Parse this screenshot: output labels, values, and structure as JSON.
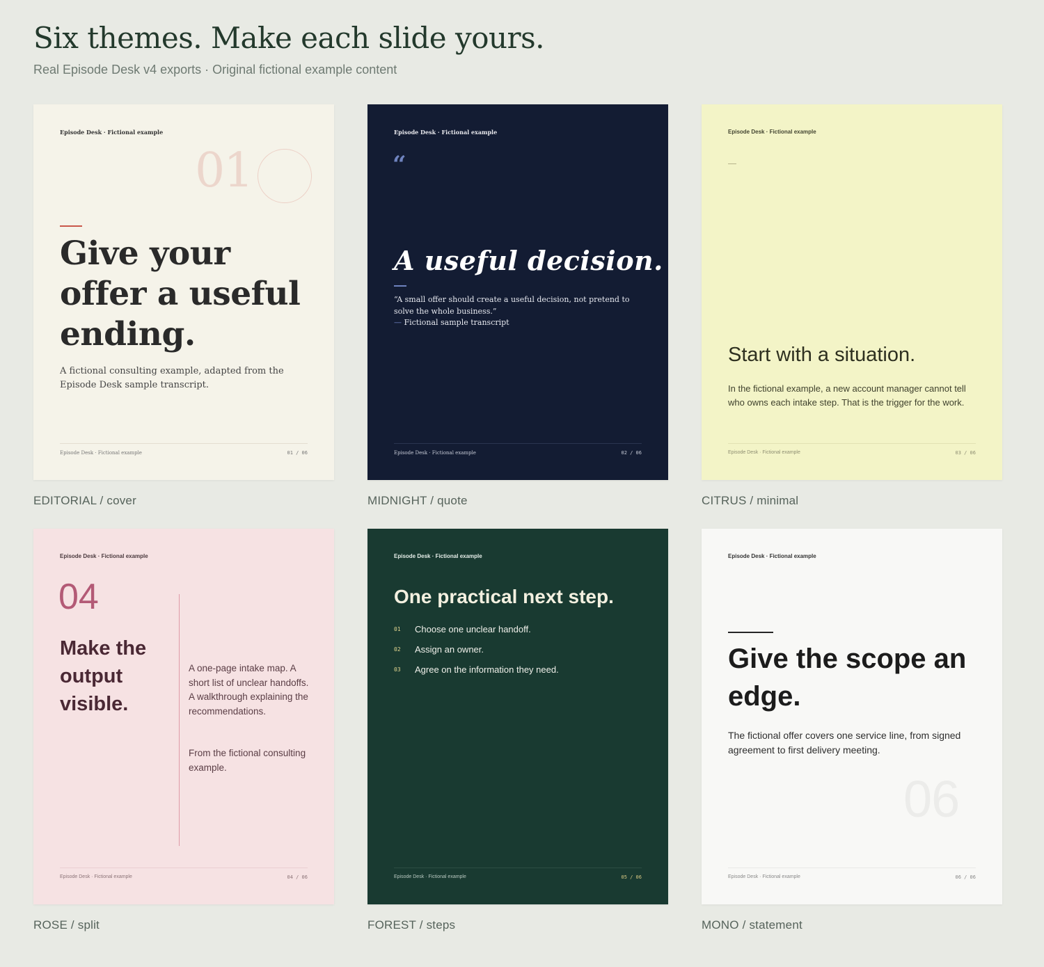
{
  "header": {
    "title": "Six themes. Make each slide yours.",
    "subtitle": "Real Episode Desk v4 exports · Original fictional example content"
  },
  "brand_label": "Episode Desk · Fictional example",
  "cards": [
    {
      "caption": "EDITORIAL / cover",
      "number": "01",
      "headline": "Give your offer a useful ending.",
      "body": "A fictional consulting example, adapted from the Episode Desk sample transcript.",
      "pager": "01 / 06",
      "colors": {
        "background": "#f5f3e9",
        "accent": "#c9574a"
      }
    },
    {
      "caption": "MIDNIGHT / quote",
      "quote_mark": "“",
      "headline": "A useful decision.",
      "quote": "“A small offer should create a useful decision, not pretend to solve the whole business.”",
      "attribution_dash": "—",
      "attribution": "Fictional sample transcript",
      "pager": "02 / 06",
      "colors": {
        "background": "#131c33",
        "accent": "#6f83bf"
      }
    },
    {
      "caption": "CITRUS / minimal",
      "headline": "Start with a situation.",
      "body": "In the fictional example, a new account manager cannot tell who owns each intake step. That is the trigger for the work.",
      "pager": "03 / 06",
      "colors": {
        "background": "#f3f4c7"
      }
    },
    {
      "caption": "ROSE / split",
      "number": "04",
      "headline": "Make the output visible.",
      "body": "A one-page intake map. A short list of unclear handoffs. A walkthrough explaining the recommendations.",
      "body2": "From the fictional consulting example.",
      "pager": "04 / 06",
      "colors": {
        "background": "#f6e2e3",
        "accent": "#b35a76"
      }
    },
    {
      "caption": "FOREST / steps",
      "headline": "One practical next step.",
      "steps": [
        {
          "num": "01",
          "text": "Choose one unclear handoff."
        },
        {
          "num": "02",
          "text": "Assign an owner."
        },
        {
          "num": "03",
          "text": "Agree on the information they need."
        }
      ],
      "pager": "05 / 06",
      "colors": {
        "background": "#193a31",
        "accent": "#e3d690"
      }
    },
    {
      "caption": "MONO / statement",
      "headline": "Give the scope an edge.",
      "body": "The fictional offer covers one service line, from signed agreement to first delivery meeting.",
      "number": "06",
      "pager": "06 / 06",
      "colors": {
        "background": "#f8f8f6",
        "accent": "#262626"
      }
    }
  ]
}
